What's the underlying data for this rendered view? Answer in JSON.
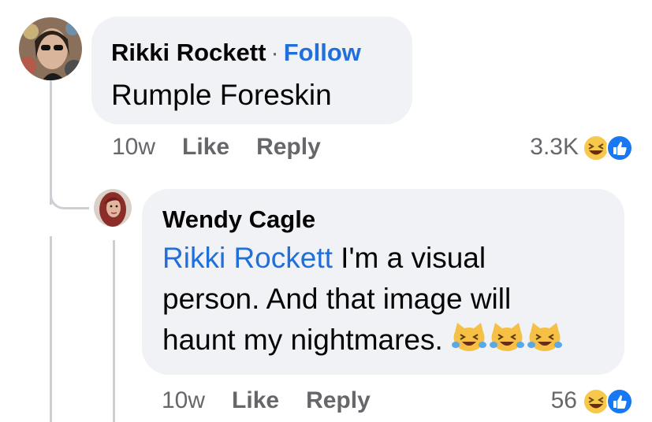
{
  "comment": {
    "author": "Rikki Rockett",
    "separator": "·",
    "follow_label": "Follow",
    "text": "Rumple Foreskin",
    "time": "10w",
    "like_label": "Like",
    "reply_label": "Reply",
    "reaction_count": "3.3K",
    "reaction_icons": [
      "laughing-face-icon",
      "thumbs-up-icon"
    ]
  },
  "reply": {
    "author": "Wendy Cagle",
    "mention": "Rikki Rockett",
    "text_line1": " I'm a visual",
    "text_line2": "person. And that image will",
    "text_line3": "haunt my nightmares.",
    "emoji_icons": [
      "cat-tears-of-joy-icon",
      "cat-tears-of-joy-icon",
      "cat-tears-of-joy-icon"
    ],
    "time": "10w",
    "like_label": "Like",
    "reply_label": "Reply",
    "reaction_count": "56",
    "reaction_icons": [
      "laughing-face-icon",
      "thumbs-up-icon"
    ]
  },
  "colors": {
    "link_blue": "#216fdb",
    "bubble_bg": "#f0f2f5",
    "meta_gray": "#65676b",
    "thread_line": "#ccd0d5"
  }
}
